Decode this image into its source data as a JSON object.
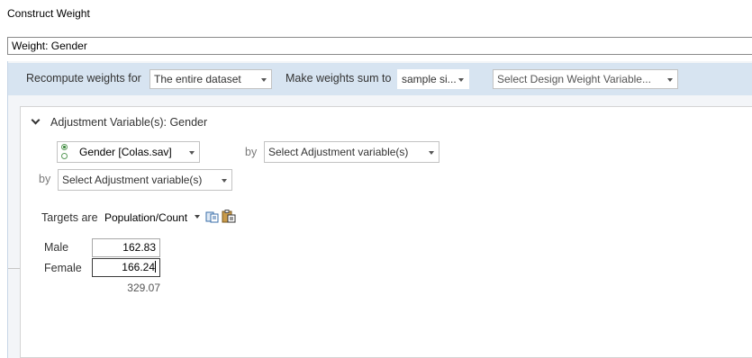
{
  "window": {
    "title": "Construct Weight"
  },
  "name_field": {
    "value": "Weight: Gender"
  },
  "toolbar": {
    "recompute_label": "Recompute weights for",
    "recompute_value": "The entire dataset",
    "sum_label": "Make weights sum to",
    "sum_value": "sample si...",
    "design_weight_placeholder": "Select Design Weight Variable..."
  },
  "adjustment": {
    "header": "Adjustment Variable(s): Gender",
    "variable": "Gender [Colas.sav]",
    "by_label": "by",
    "select_placeholder": "Select Adjustment variable(s)"
  },
  "targets": {
    "label": "Targets are",
    "type": "Population/Count",
    "rows": [
      {
        "label": "Male",
        "value": "162.83"
      },
      {
        "label": "Female",
        "value": "166.24"
      }
    ],
    "total": "329.07"
  }
}
